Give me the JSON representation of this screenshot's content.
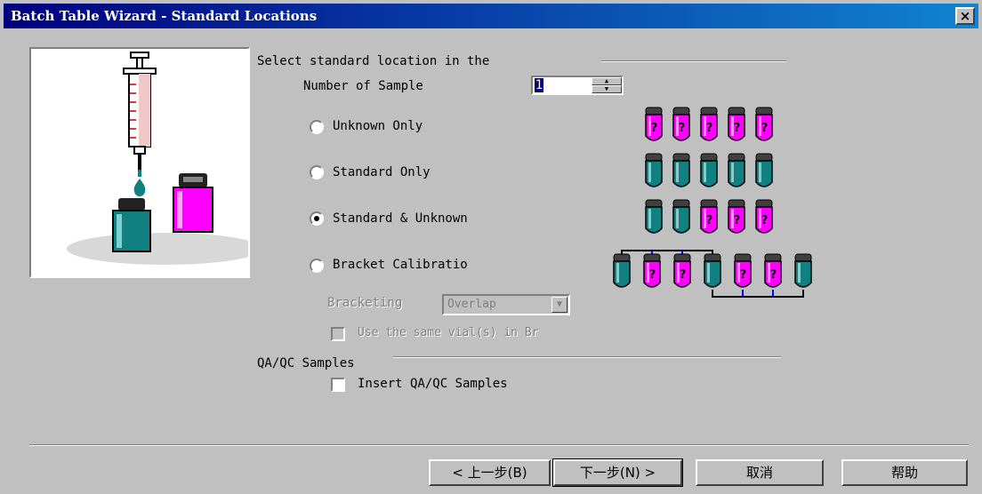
{
  "window": {
    "title": "Batch Table Wizard - Standard Locations",
    "close_label": "×"
  },
  "location_group": {
    "title": "Select standard location in the"
  },
  "number_of_sample": {
    "label": "Number of Sample",
    "value": "1"
  },
  "options": [
    {
      "label": "Unknown Only",
      "selected": false,
      "pattern": [
        "U",
        "U",
        "U",
        "U",
        "U"
      ]
    },
    {
      "label": "Standard Only",
      "selected": false,
      "pattern": [
        "S",
        "S",
        "S",
        "S",
        "S"
      ]
    },
    {
      "label": "Standard & Unknown",
      "selected": true,
      "pattern": [
        "S",
        "S",
        "U",
        "U",
        "U"
      ]
    },
    {
      "label": "Bracket Calibratio",
      "selected": false,
      "pattern": [
        "S",
        "U",
        "U",
        "S",
        "U",
        "U",
        "S"
      ]
    }
  ],
  "bracketing": {
    "label": "Bracketing",
    "value": "Overlap",
    "enabled": false
  },
  "same_vial": {
    "label": "Use the same vial(s) in Br",
    "checked": false,
    "enabled": false
  },
  "qaqc_group": {
    "title": "QA/QC Samples"
  },
  "insert_qaqc": {
    "label": "Insert QA/QC Samples",
    "checked": false
  },
  "buttons": {
    "back": "< 上一步(B)",
    "next": "下一步(N) >",
    "cancel": "取消",
    "help": "帮助"
  },
  "colors": {
    "title_start": "#000080",
    "title_end": "#1084d0",
    "standard_vial": "#108080",
    "unknown_vial": "#ff00ff",
    "dialog_bg": "#c0c0c0"
  },
  "icons": {
    "vial_unknown": "vial-question-icon",
    "vial_standard": "vial-standard-icon",
    "syringe": "syringe-icon"
  }
}
